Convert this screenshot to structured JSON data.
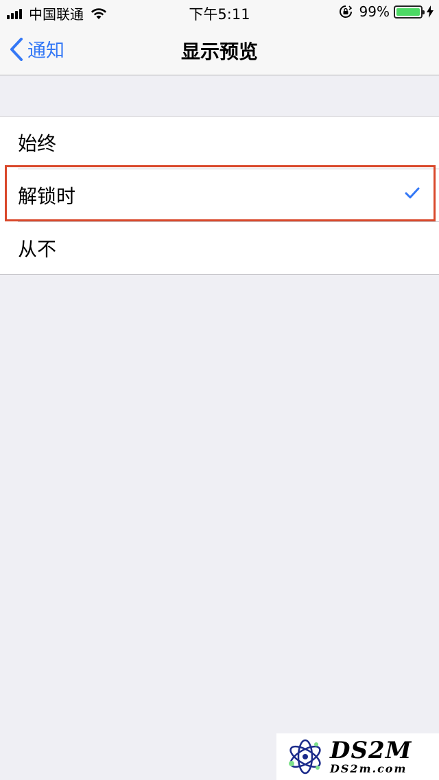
{
  "status_bar": {
    "carrier": "中国联通",
    "time": "下午5:11",
    "battery_percent": "99%",
    "battery_level": 0.99
  },
  "nav": {
    "back_label": "通知",
    "title": "显示预览"
  },
  "options": [
    {
      "label": "始终",
      "selected": false
    },
    {
      "label": "解锁时",
      "selected": true
    },
    {
      "label": "从不",
      "selected": false
    }
  ],
  "watermark": {
    "brand": "DS2M",
    "site": "DS2m.com"
  },
  "colors": {
    "accent": "#3478f6",
    "highlight_border": "#d9482b",
    "background": "#efeff4"
  }
}
